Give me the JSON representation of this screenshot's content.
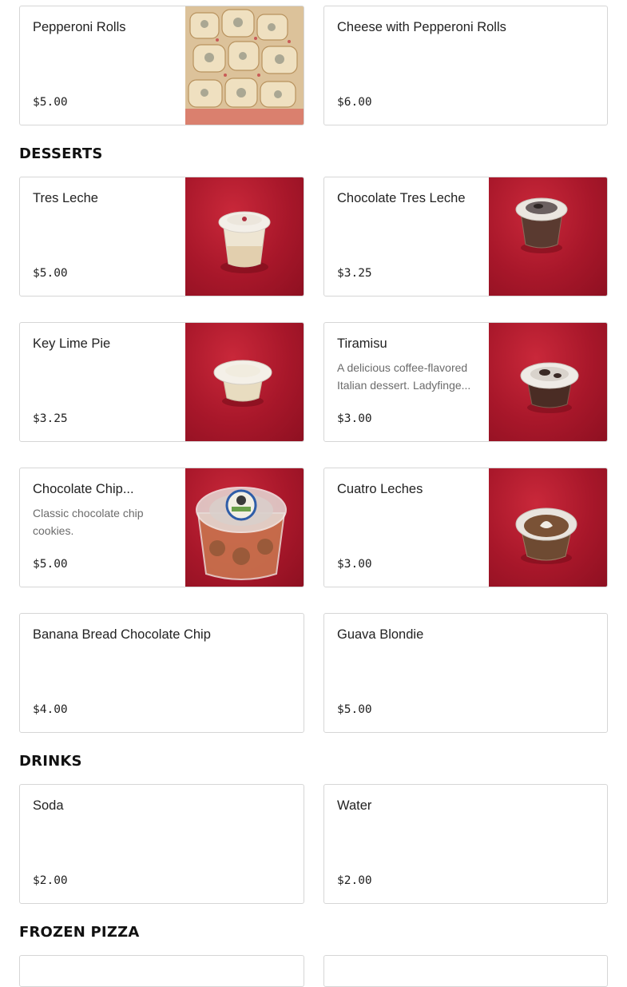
{
  "top_items": [
    {
      "name": "Pepperoni Rolls",
      "price": "$5.00",
      "icon": "pepperoni-rolls-photo"
    },
    {
      "name": "Cheese with Pepperoni Rolls",
      "price": "$6.00"
    }
  ],
  "sections": {
    "desserts": {
      "title": "DESSERTS",
      "items": [
        {
          "name": "Tres Leche",
          "price": "$5.00",
          "icon": "dessert-cup-photo"
        },
        {
          "name": "Chocolate Tres Leche",
          "price": "$3.25",
          "icon": "dessert-cup-photo"
        },
        {
          "name": "Key Lime Pie",
          "price": "$3.25",
          "icon": "dessert-cup-photo"
        },
        {
          "name": "Tiramisu",
          "description": "A delicious coffee-flavored Italian dessert. Ladyfinge...",
          "price": "$3.00",
          "icon": "dessert-cup-photo"
        },
        {
          "name": "Chocolate Chip...",
          "description": "Classic chocolate chip cookies.",
          "price": "$5.00",
          "icon": "cookie-container-photo"
        },
        {
          "name": "Cuatro Leches",
          "price": "$3.00",
          "icon": "dessert-cup-photo"
        },
        {
          "name": "Banana Bread Chocolate Chip",
          "price": "$4.00"
        },
        {
          "name": "Guava Blondie",
          "price": "$5.00"
        }
      ]
    },
    "drinks": {
      "title": "DRINKS",
      "items": [
        {
          "name": "Soda",
          "price": "$2.00"
        },
        {
          "name": "Water",
          "price": "$2.00"
        }
      ]
    },
    "frozen_pizza": {
      "title": "FROZEN PIZZA"
    }
  },
  "colors": {
    "photo_background": "#a8172a",
    "card_border": "#d6d6d6",
    "description_text": "#6b6b6b"
  }
}
